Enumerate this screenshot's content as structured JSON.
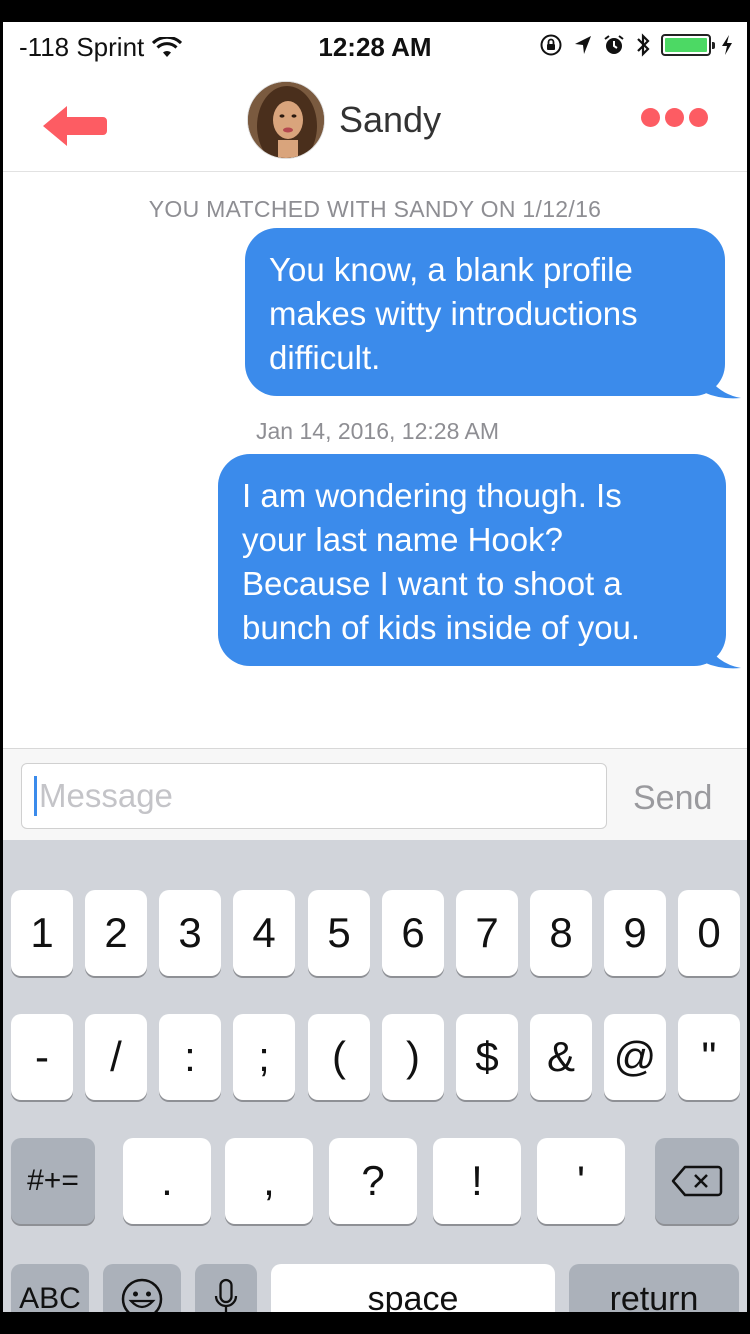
{
  "status_bar": {
    "carrier": "-118 Sprint",
    "time": "12:28 AM"
  },
  "header": {
    "contact_name": "Sandy"
  },
  "chat": {
    "match_banner": "YOU MATCHED WITH SANDY ON 1/12/16",
    "messages": [
      {
        "lines": [
          "You know, a blank profile",
          "makes witty introductions",
          "difficult."
        ]
      },
      {
        "timestamp": "Jan 14, 2016, 12:28 AM",
        "lines": [
          "I am wondering though.  Is",
          "your last name Hook?",
          "Because I want to shoot a",
          "bunch of kids inside of you."
        ]
      }
    ]
  },
  "composer": {
    "placeholder": "Message",
    "send_label": "Send"
  },
  "keyboard": {
    "row1": [
      "1",
      "2",
      "3",
      "4",
      "5",
      "6",
      "7",
      "8",
      "9",
      "0"
    ],
    "row2": [
      "-",
      "/",
      ":",
      ";",
      "(",
      ")",
      "$",
      "&",
      "@",
      "\""
    ],
    "row3": [
      ".",
      ",",
      "?",
      "!",
      "'"
    ],
    "symbols_label": "#+=",
    "abc_label": "ABC",
    "space_label": "space",
    "return_label": "return"
  },
  "colors": {
    "accent": "#fd5c63",
    "bubble": "#3b8beb",
    "battery": "#4cd964"
  }
}
